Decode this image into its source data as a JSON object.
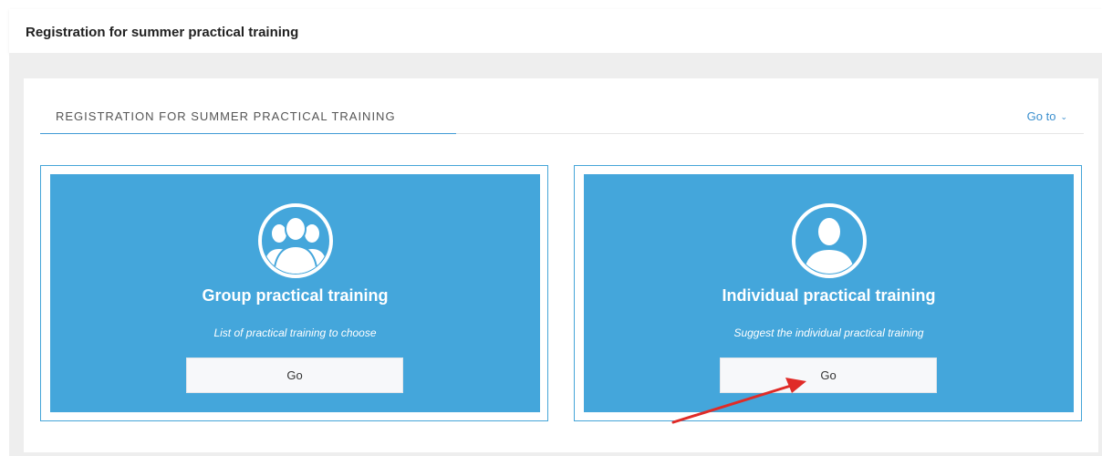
{
  "header": {
    "title": "Registration for summer practical training"
  },
  "portlet": {
    "caption": "REGISTRATION FOR SUMMER PRACTICAL TRAINING",
    "goto_label": "Go to",
    "goto_icon": "chevron-down-icon"
  },
  "cards": [
    {
      "icon": "users-group-icon",
      "title": "Group practical training",
      "subtitle": "List of practical training to choose",
      "button": "Go"
    },
    {
      "icon": "user-icon",
      "title": "Individual practical training",
      "subtitle": "Suggest the individual practical training",
      "button": "Go"
    }
  ],
  "colors": {
    "card_bg": "#44a6db",
    "accent": "#3a8fce",
    "annotation_arrow": "#e02b27"
  }
}
